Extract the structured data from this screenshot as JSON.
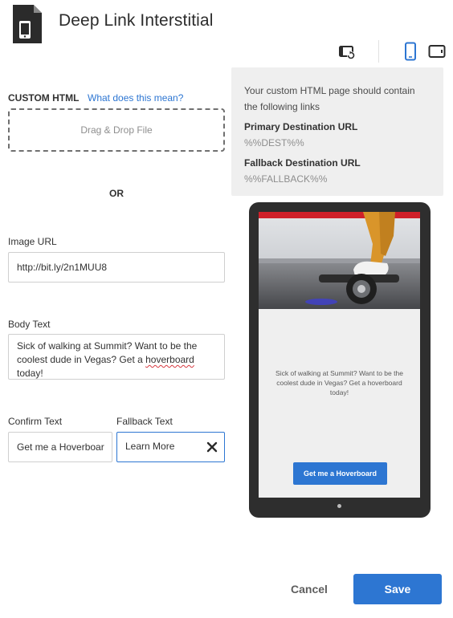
{
  "header": {
    "title": "Deep Link Interstitial",
    "app_icon": "mobile-document-icon"
  },
  "toolbar": {
    "rotate_icon": "rotate-device-icon",
    "phone_icon": "phone-portrait-icon",
    "tablet_icon": "tablet-landscape-icon",
    "active_device": "phone"
  },
  "tooltip": {
    "intro": "Your custom HTML page should contain the following links",
    "primary_label": "Primary Destination URL",
    "primary_value": "%%DEST%%",
    "fallback_label": "Fallback Destination URL",
    "fallback_value": "%%FALLBACK%%"
  },
  "form": {
    "custom_html_label": "CUSTOM HTML",
    "help_link": "What does this mean?",
    "dropzone_label": "Drag & Drop File",
    "or_label": "OR",
    "image_url_label": "Image URL",
    "image_url_value": "http://bit.ly/2n1MUU8",
    "body_text_label": "Body Text",
    "body_text_before": "Sick of walking at Summit? Want to be the coolest dude in Vegas? Get a ",
    "body_text_misspelled": "hoverboard",
    "body_text_after": " today!",
    "confirm_label": "Confirm Text",
    "confirm_value": "Get me a Hoverboar",
    "fallback_label": "Fallback Text",
    "fallback_value": "Learn More",
    "clear_icon": "close-icon"
  },
  "preview": {
    "body": "Sick of walking at Summit? Want to be the coolest dude in Vegas? Get a hoverboard today!",
    "cta": "Get me a Hoverboard"
  },
  "footer": {
    "cancel": "Cancel",
    "save": "Save"
  },
  "colors": {
    "accent": "#2d76d2",
    "tooltip_bg": "#efefef",
    "device_frame": "#2e2e2e"
  }
}
